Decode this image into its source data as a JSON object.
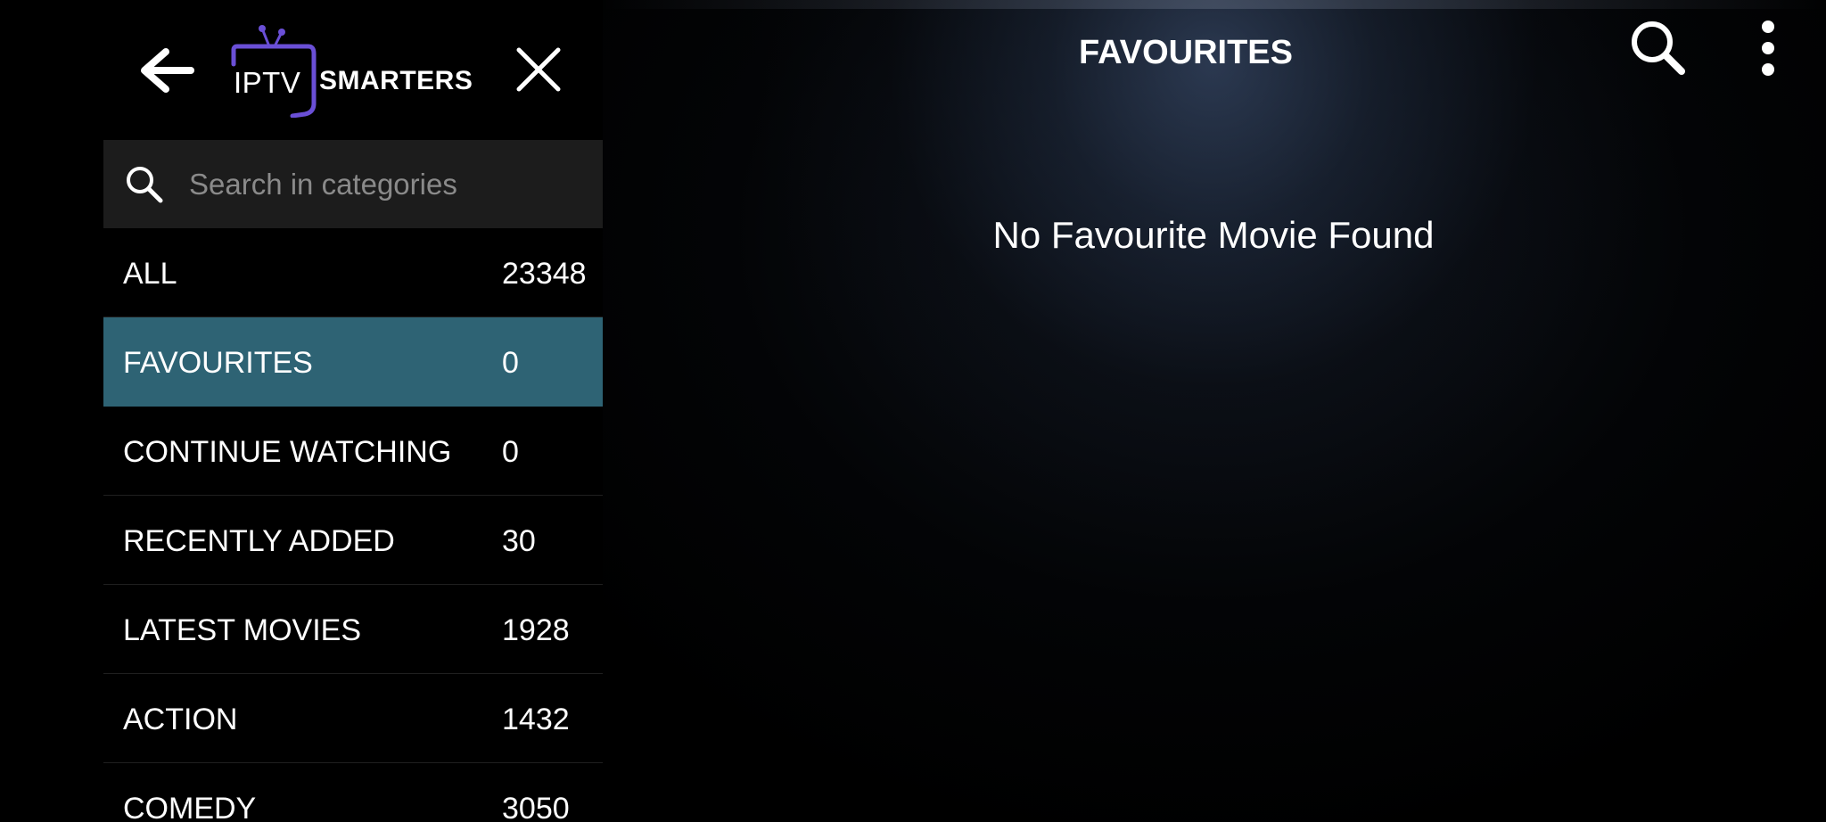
{
  "drawer": {
    "logo": {
      "iptv": "IPTV",
      "smarters": "SMARTERS"
    },
    "search": {
      "placeholder": "Search in categories",
      "value": ""
    },
    "categories": [
      {
        "label": "ALL",
        "count": "23348",
        "selected": false
      },
      {
        "label": "FAVOURITES",
        "count": "0",
        "selected": true
      },
      {
        "label": "CONTINUE WATCHING",
        "count": "0",
        "selected": false
      },
      {
        "label": "RECENTLY ADDED",
        "count": "30",
        "selected": false
      },
      {
        "label": "LATEST MOVIES",
        "count": "1928",
        "selected": false
      },
      {
        "label": "ACTION",
        "count": "1432",
        "selected": false
      },
      {
        "label": "COMEDY",
        "count": "3050",
        "selected": false
      }
    ]
  },
  "header": {
    "title": "FAVOURITES"
  },
  "main": {
    "empty_message": "No Favourite Movie Found"
  },
  "icons": {
    "back": "arrow-left-icon",
    "close": "close-icon",
    "search": "search-icon",
    "menu": "more-vertical-icon",
    "logo_tv": "tv-antenna-icon"
  },
  "colors": {
    "selected_row": "#2e6374",
    "search_bg": "#1c1c1c",
    "logo_accent": "#6a4fd6",
    "background": "#000000"
  }
}
